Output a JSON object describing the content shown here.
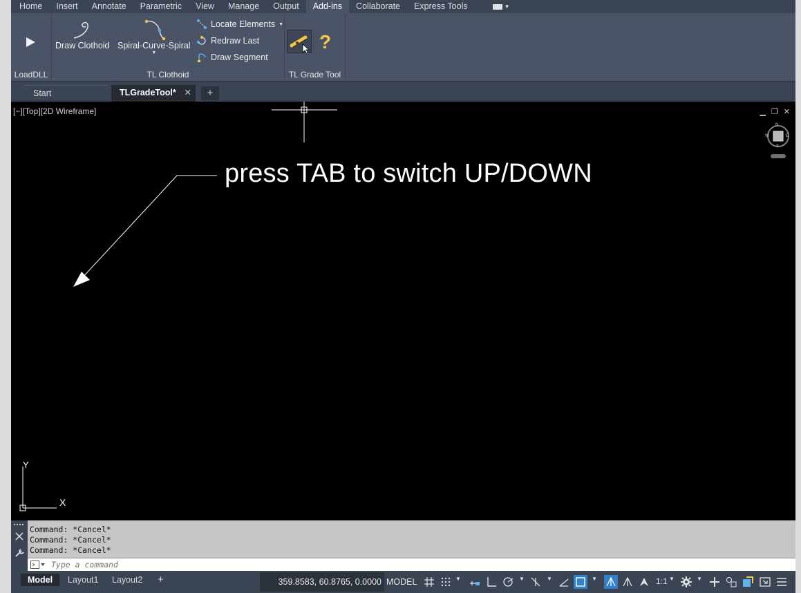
{
  "ribbon": {
    "tabs": [
      "Home",
      "Insert",
      "Annotate",
      "Parametric",
      "View",
      "Manage",
      "Output",
      "Add-ins",
      "Collaborate",
      "Express Tools"
    ],
    "active_tab": "Add-ins"
  },
  "panels": {
    "loaddll": {
      "title": "LoadDLL"
    },
    "clothoid": {
      "title": "TL Clothoid",
      "draw_clothoid": "Draw Clothoid",
      "spiral": "Spiral-Curve-Spiral",
      "locate": "Locate Elements",
      "redraw": "Redraw Last",
      "segment": "Draw Segment"
    },
    "grade": {
      "title": "TL Grade Tool"
    }
  },
  "file_tabs": {
    "start": "Start",
    "active": "TLGradeTool*",
    "close_glyph": "✕",
    "plus": "+"
  },
  "viewport": {
    "label": "[−][Top][2D Wireframe]",
    "overlay": "press TAB to switch UP/DOWN",
    "ucs_x": "X",
    "ucs_y": "Y",
    "viewcube": {
      "n": "N",
      "s": "S",
      "e": "E",
      "w": "W"
    }
  },
  "command": {
    "history": [
      "Command: *Cancel*",
      "Command: *Cancel*",
      "Command: *Cancel*"
    ],
    "placeholder": "Type a command"
  },
  "statusbar": {
    "layouts": [
      "Model",
      "Layout1",
      "Layout2"
    ],
    "add": "+",
    "coords": "359.8583, 60.8765, 0.0000",
    "model": "MODEL",
    "scale": "1:1"
  }
}
